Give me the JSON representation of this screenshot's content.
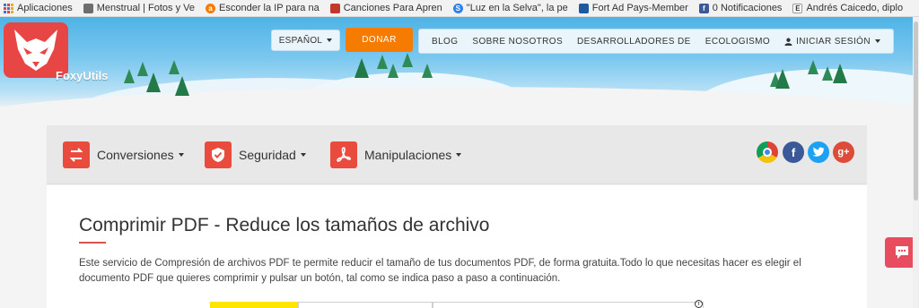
{
  "bookmarks": [
    {
      "label": "Aplicaciones",
      "icon": "apps-icon"
    },
    {
      "label": "Menstrual | Fotos y Ve",
      "icon": "bookmark-favicon"
    },
    {
      "label": "Esconder la IP para na",
      "icon": "bookmark-favicon",
      "color": "#f57c00"
    },
    {
      "label": "Canciones Para Apren",
      "icon": "bookmark-favicon"
    },
    {
      "label": "\"Luz en la Selva\", la pe",
      "icon": "bookmark-favicon",
      "color": "#2f80ed"
    },
    {
      "label": "Fort Ad Pays-Member",
      "icon": "bookmark-favicon"
    },
    {
      "label": "0 Notificaciones",
      "icon": "facebook-icon",
      "color": "#3b5998"
    },
    {
      "label": "Andrés Caicedo, diplo",
      "icon": "bookmark-favicon"
    }
  ],
  "header": {
    "brand": "FoxyUtils",
    "language_label": "ESPAÑOL",
    "donate_label": "DONAR",
    "nav": [
      "BLOG",
      "SOBRE NOSOTROS",
      "DESARROLLADORES DE",
      "ECOLOGISMO"
    ],
    "login_label": "INICIAR SESIÓN"
  },
  "tools": [
    {
      "label": "Conversiones",
      "icon": "convert-arrows-icon"
    },
    {
      "label": "Seguridad",
      "icon": "shield-check-icon"
    },
    {
      "label": "Manipulaciones",
      "icon": "pdf-acrobat-icon"
    }
  ],
  "social": [
    {
      "name": "chrome-icon",
      "color": "#4caf50"
    },
    {
      "name": "facebook-icon",
      "glyph": "f",
      "color": "#3b5998"
    },
    {
      "name": "twitter-icon",
      "color": "#1da1f2"
    },
    {
      "name": "google-plus-icon",
      "glyph": "g+",
      "color": "#dd4b39"
    }
  ],
  "main": {
    "title": "Comprimir PDF - Reduce los tamaños de archivo",
    "description": "Este servicio de Compresión de archivos PDF te permite reducir el tamaño de tus documentos PDF, de forma gratuita.Todo lo que necesitas hacer es elegir el documento PDF que quieres comprimir y pulsar un botón, tal como se indica paso a paso a continuación."
  },
  "colors": {
    "accent": "#e94c3d",
    "donate": "#f57c00",
    "upload": "#ffe600"
  }
}
